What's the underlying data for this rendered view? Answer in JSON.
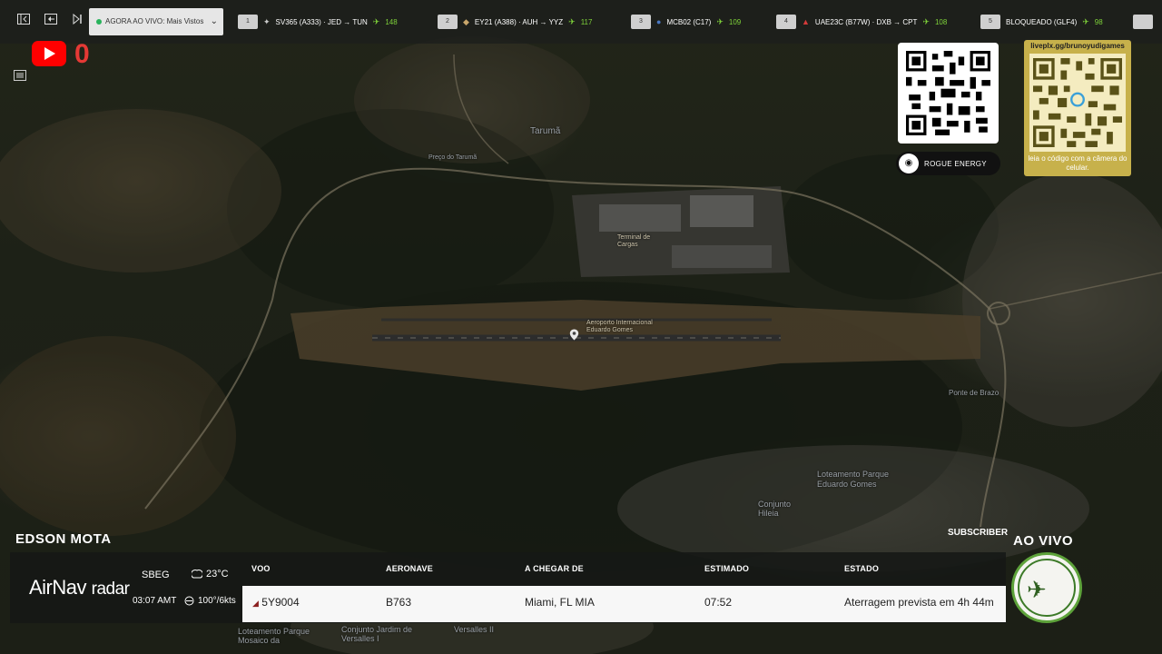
{
  "toolbar": {
    "live_label": "AGORA AO VIVO: Mais Vistos",
    "slots": [
      {
        "num": "1",
        "text": "SV365 (A333) · JED → TUN",
        "count": "148"
      },
      {
        "num": "2",
        "text": "EY21 (A388) · AUH → YYZ",
        "count": "117"
      },
      {
        "num": "3",
        "text": "MCB02 (C17)",
        "count": "109"
      },
      {
        "num": "4",
        "text": "UAE23C (B77W) · DXB → CPT",
        "count": "108"
      },
      {
        "num": "5",
        "text": "BLOQUEADO (GLF4)",
        "count": "98"
      }
    ]
  },
  "youtube": {
    "count": "0"
  },
  "map": {
    "labels": {
      "taruma": "Tarumã",
      "aeroporto": "Aeroporto Internacional Eduardo Gomes",
      "terminal": "Terminal de Cargas",
      "loteamento": "Loteamento Parque Eduardo Gomes",
      "conjunto": "Conjunto Hileia",
      "ponte": "Ponte de Brazo",
      "versalles": "Versalles II",
      "conjunto2": "Conjunto Jardim de Versalles I",
      "loteamento2": "Loteamento Parque Mosaico da",
      "preco": "Preço do Tarumã"
    }
  },
  "qr": {
    "url_text": "liveplx.gg/brunoyudigames",
    "caption": "leia o código com a câmera do celular.",
    "sponsor": "ROGUE ENERGY"
  },
  "overlay": {
    "streamer": "EDSON MOTA",
    "subscriber": "SUBSCRIBER",
    "live": "AO VIVO"
  },
  "panel": {
    "brand_main": "AirNav",
    "brand_sub": "radar",
    "airport": "SBEG",
    "time": "03:07 AMT",
    "temp": "23°C",
    "wind": "100°/6kts",
    "headers": {
      "flight": "VOO",
      "aircraft": "AERONAVE",
      "origin": "A CHEGAR DE",
      "eta": "ESTIMADO",
      "status": "ESTADO"
    },
    "row": {
      "flight": "5Y9004",
      "aircraft": "B763",
      "origin": "Miami, FL MIA",
      "eta": "07:52",
      "status": "Aterragem prevista em 4h 44m"
    }
  },
  "colors": {
    "youtube_red": "#ff0000",
    "count_green": "#7fd33a",
    "qr_gold": "#c7b14b"
  }
}
